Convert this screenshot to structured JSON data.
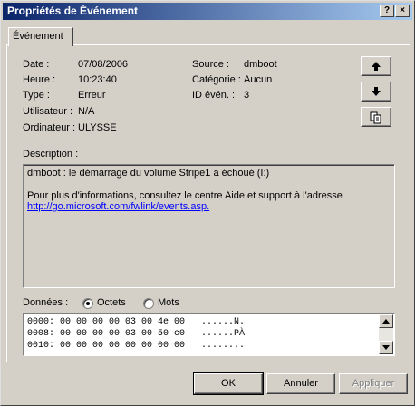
{
  "window": {
    "title": "Propriétés de Événement",
    "help_label": "?",
    "close_label": "×"
  },
  "tab": {
    "label": "Événement"
  },
  "fields": {
    "date": {
      "label": "Date :",
      "value": "07/08/2006"
    },
    "heure": {
      "label": "Heure :",
      "value": "10:23:40"
    },
    "type": {
      "label": "Type :",
      "value": "Erreur"
    },
    "utilisateur": {
      "label": "Utilisateur :",
      "value": "N/A"
    },
    "ordinateur": {
      "label": "Ordinateur :",
      "value": "ULYSSE"
    },
    "source": {
      "label": "Source :",
      "value": "dmboot"
    },
    "categorie": {
      "label": "Catégorie :",
      "value": "Aucun"
    },
    "id": {
      "label": "ID évén. :",
      "value": "3"
    }
  },
  "side_buttons": {
    "up": "arrow-up-icon",
    "down": "arrow-down-icon",
    "copy": "copy-icon"
  },
  "description": {
    "label": "Description :",
    "line1": "dmboot : le démarrage du volume Stripe1 a échoué (I:)",
    "line2": "Pour plus d'informations, consultez le centre Aide et support à l'adresse",
    "link": "http://go.microsoft.com/fwlink/events.asp."
  },
  "donnees": {
    "label": "Données :",
    "opt_octets": "Octets",
    "opt_mots": "Mots",
    "selected": "Octets",
    "rows": [
      "0000: 00 00 00 00 03 00 4e 00   ......N.",
      "0008: 00 00 00 00 03 00 50 c0   ......PÀ",
      "0010: 00 00 00 00 00 00 00 00   ........"
    ]
  },
  "buttons": {
    "ok": "OK",
    "annuler": "Annuler",
    "appliquer": "Appliquer"
  }
}
